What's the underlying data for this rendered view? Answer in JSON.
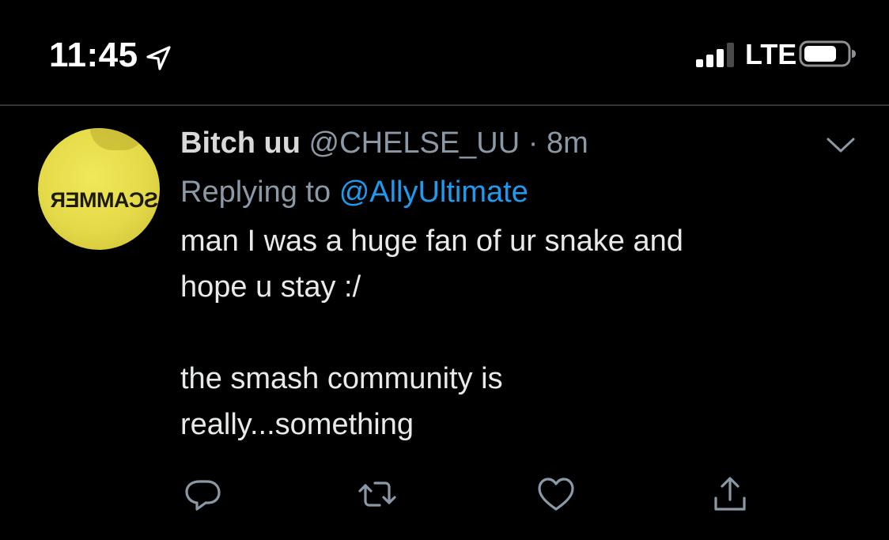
{
  "status_bar": {
    "time": "11:45",
    "location_icon": "location-arrow-icon",
    "signal_icon": "cellular-signal-icon",
    "network": "LTE",
    "battery_icon": "battery-icon"
  },
  "tweet": {
    "avatar_icon": "user-avatar",
    "avatar_text": "SCAMMER",
    "display_name": "Bitch uu",
    "handle": "@CHELSE_UU",
    "separator": "·",
    "time": "8m",
    "reply_prefix": "Replying to",
    "reply_mention": "@AllyUltimate",
    "text": "man I was a huge fan of ur snake and\nhope u stay :/\n\nthe smash community is\nreally...something",
    "more_icon": "chevron-down-icon",
    "actions": {
      "reply_icon": "reply-icon",
      "retweet_icon": "retweet-icon",
      "like_icon": "heart-icon",
      "share_icon": "share-icon"
    }
  },
  "colors": {
    "background": "#000000",
    "secondary_text": "#8b98a5",
    "link": "#1d9bf0",
    "primary_text": "#e7e9ea",
    "divider": "#2f3336"
  }
}
